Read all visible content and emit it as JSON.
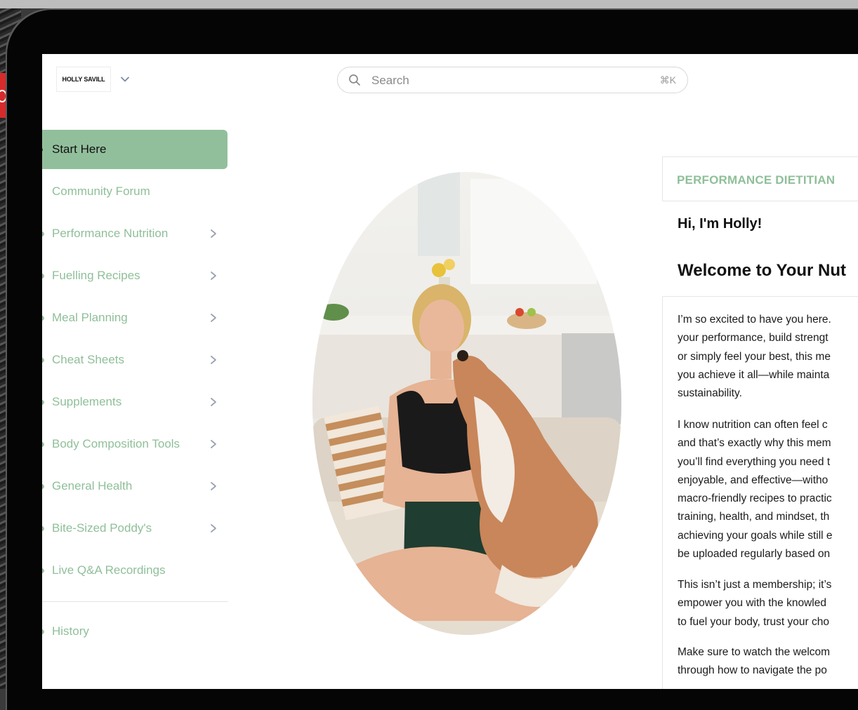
{
  "brand": {
    "logo_text": "HOLLY SAVILL"
  },
  "search": {
    "placeholder": "Search",
    "shortcut": "⌘K"
  },
  "sidebar": {
    "items": [
      {
        "label": "Start Here",
        "active": true,
        "has_children": false
      },
      {
        "label": "Community Forum",
        "active": false,
        "has_children": false
      },
      {
        "label": "Performance Nutrition",
        "active": false,
        "has_children": true
      },
      {
        "label": "Fuelling Recipes",
        "active": false,
        "has_children": true
      },
      {
        "label": "Meal Planning",
        "active": false,
        "has_children": true
      },
      {
        "label": "Cheat Sheets",
        "active": false,
        "has_children": true
      },
      {
        "label": "Supplements",
        "active": false,
        "has_children": true
      },
      {
        "label": "Body Composition Tools",
        "active": false,
        "has_children": true
      },
      {
        "label": "General Health",
        "active": false,
        "has_children": true
      },
      {
        "label": "Bite-Sized Poddy's",
        "active": false,
        "has_children": true
      },
      {
        "label": "Live Q&A Recordings",
        "active": false,
        "has_children": false
      }
    ],
    "history_label": "History"
  },
  "content": {
    "badge": "PERFORMANCE DIETITIAN",
    "greeting": "Hi, I'm Holly!",
    "title": "Welcome to Your Nut",
    "paragraphs": [
      [
        "I’m so excited to have you here.",
        "your performance, build strengt",
        "or simply feel your best, this me",
        "you achieve it all—while mainta",
        "sustainability."
      ],
      [
        "I know nutrition can often feel c",
        "and that’s exactly why this mem",
        "you’ll find everything you need t",
        "enjoyable, and effective—witho",
        "macro-friendly recipes to practic",
        "training, health, and mindset, th",
        "achieving your goals while still e",
        "be uploaded regularly based on"
      ],
      [
        "This isn’t just a membership; it’s",
        "empower you with the knowled",
        "to fuel your body, trust your cho"
      ],
      [
        "Make sure to watch the welcom",
        "through how to navigate the po"
      ]
    ]
  },
  "colors": {
    "accent": "#92bf9b",
    "accent_text": "#8fbf99",
    "device_frame": "#050505",
    "text": "#111111"
  }
}
